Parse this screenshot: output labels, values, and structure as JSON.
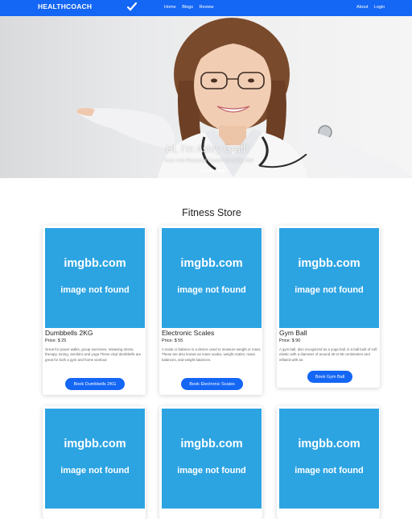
{
  "navbar": {
    "brand": "HEALTHCOACH",
    "links": [
      "Home",
      "Blogs",
      "Review"
    ],
    "right_links": [
      "About",
      "Login"
    ]
  },
  "hero": {
    "title": "Hi, I'm Asley Graff!",
    "subtitle": "Your new Personal Coach for better life!",
    "slides_total": 3,
    "active_slide": 3
  },
  "store": {
    "title": "Fitness Store",
    "image_placeholder": {
      "line1": "imgbb.com",
      "line2": "image not found"
    },
    "products": [
      {
        "name": "Dumbbells 2KG",
        "price": "Price: $ 25",
        "description": "Great for power walks, group exercises, releasing stress, therapy, toning, aerobics and yoga These vinyl dumbbells are great for both a gym and home workout",
        "button": "Book Dumbbells 2KG"
      },
      {
        "name": "Electronic Scales",
        "price": "Price: $ 55",
        "description": "A scale or balance is a device used to measure weight or mass. These are also known as mass scales, weight scales, mass balances, and weight balances.",
        "button": "Book Electronic Scales"
      },
      {
        "name": "Gym Ball",
        "price": "Price: $ 90",
        "description": "A gym ball, also recognized as a yoga ball, is a ball built of soft elastic with a diameter of around 35 to 85 centimeters and inflated with air.",
        "button": "Book Gym Ball"
      }
    ]
  },
  "colors": {
    "primary": "#1466f4",
    "placeholder_bg": "#2da4e2"
  }
}
